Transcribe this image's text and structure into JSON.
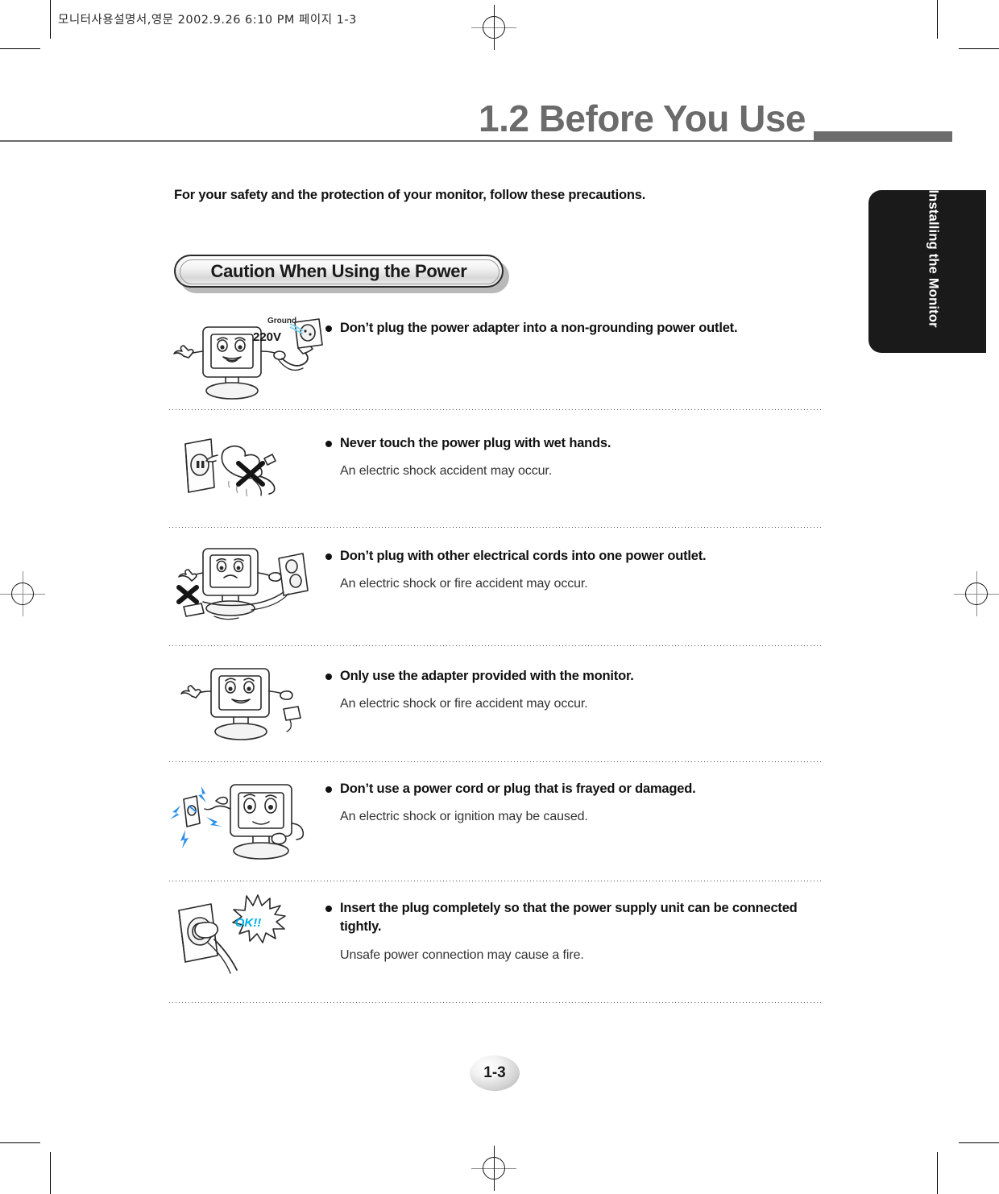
{
  "print_header": "모니터사용설명서,영문  2002.9.26 6:10 PM  페이지 1-3",
  "title": "1.2  Before You Use",
  "intro": "For your safety and the protection of your monitor, follow these precautions.",
  "side_tab": "Installing the Monitor",
  "section_banner": "Caution When Using the Power",
  "page_number": "1-3",
  "colors": {
    "title_gray": "#6b6b6b",
    "tab_black": "#1a1a1a",
    "text_black": "#111111",
    "ok_cyan": "#00b0e8",
    "spark_blue": "#1f7fe0"
  },
  "items": [
    {
      "icon": "monitor-plug-ground-illustration",
      "head": "Don’t plug the power adapter into a non-grounding power outlet.",
      "sub": "",
      "figure_labels": {
        "ground": "Ground",
        "voltage": "220V"
      }
    },
    {
      "icon": "wet-hand-plug-illustration",
      "head": "Never touch the power plug with wet hands.",
      "sub": "An electric shock accident may occur.",
      "figure_labels": {}
    },
    {
      "icon": "multiple-cords-one-outlet-illustration",
      "head": "Don’t plug with other electrical cords into one power outlet.",
      "sub": "An electric shock or fire accident may occur.",
      "figure_labels": {}
    },
    {
      "icon": "monitor-adapter-illustration",
      "head": "Only use the adapter provided with the monitor.",
      "sub": "An electric shock or fire accident may occur.",
      "figure_labels": {}
    },
    {
      "icon": "frayed-cord-illustration",
      "head": "Don’t use a power cord or plug that is frayed or damaged.",
      "sub": "An electric shock or ignition may be caused.",
      "figure_labels": {}
    },
    {
      "icon": "plug-inserted-ok-illustration",
      "head": "Insert the plug completely so that the power supply unit can be connected tightly.",
      "sub": "Unsafe power connection may cause a fire.",
      "figure_labels": {
        "ok": "OK!!"
      }
    }
  ]
}
